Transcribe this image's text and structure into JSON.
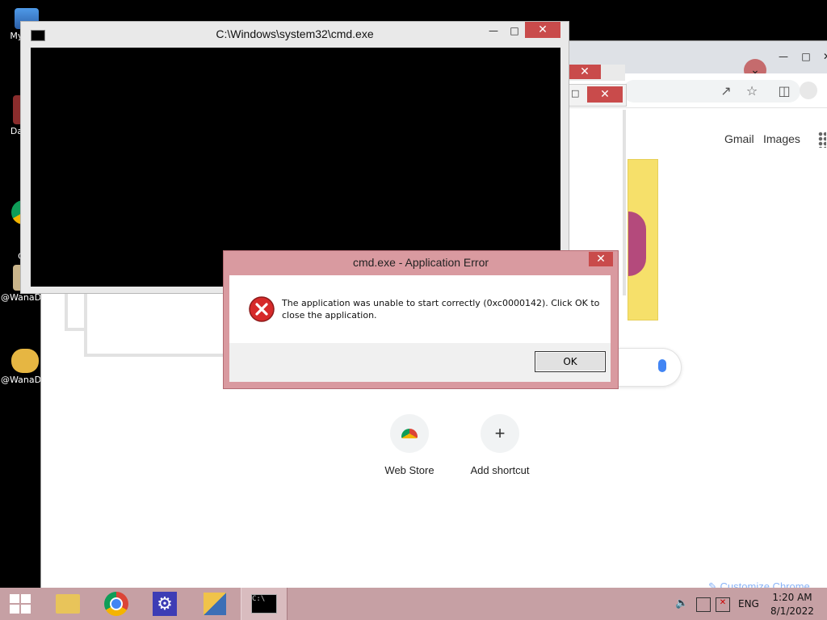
{
  "desktop": {
    "icons": [
      {
        "label": "My C",
        "icon": "computer-icon"
      },
      {
        "label": "Data",
        "icon": "database-shortcut-icon"
      },
      {
        "label": "G\nC",
        "icon": "chrome-shortcut-icon"
      },
      {
        "label": "@WanaD",
        "icon": "wannacry-decryptor-icon"
      },
      {
        "label": "@WanaD",
        "icon": "wannacry-handshake-icon"
      }
    ]
  },
  "chrome": {
    "links": {
      "gmail": "Gmail",
      "images": "Images"
    },
    "shortcuts": [
      {
        "label": "Web Store",
        "icon": "webstore-icon"
      },
      {
        "label": "Add shortcut",
        "icon": "plus-icon"
      }
    ],
    "customize_label": "Customize Chrome"
  },
  "cmd": {
    "title": "C:\\Windows\\system32\\cmd.exe",
    "icon": "cmd-icon"
  },
  "dialog": {
    "title": "cmd.exe - Application Error",
    "message": "The application was unable to start correctly (0xc0000142). Click OK to close the application.",
    "ok_label": "OK",
    "icon": "error-icon"
  },
  "taskbar": {
    "items": [
      {
        "name": "start-button",
        "icon": "windows-logo-icon"
      },
      {
        "name": "file-explorer",
        "icon": "folder-icon"
      },
      {
        "name": "chrome",
        "icon": "chrome-icon"
      },
      {
        "name": "settings",
        "icon": "gear-icon"
      },
      {
        "name": "wannacry",
        "icon": "decryptor-icon"
      },
      {
        "name": "cmd",
        "icon": "cmd-icon"
      }
    ],
    "language": "ENG",
    "time": "1:20 AM",
    "date": "8/1/2022"
  },
  "colors": {
    "dialog_frame": "#d99aa0",
    "close_button": "#c94b4b",
    "taskbar": "#c6a0a4",
    "cmd_body": "#000000"
  }
}
